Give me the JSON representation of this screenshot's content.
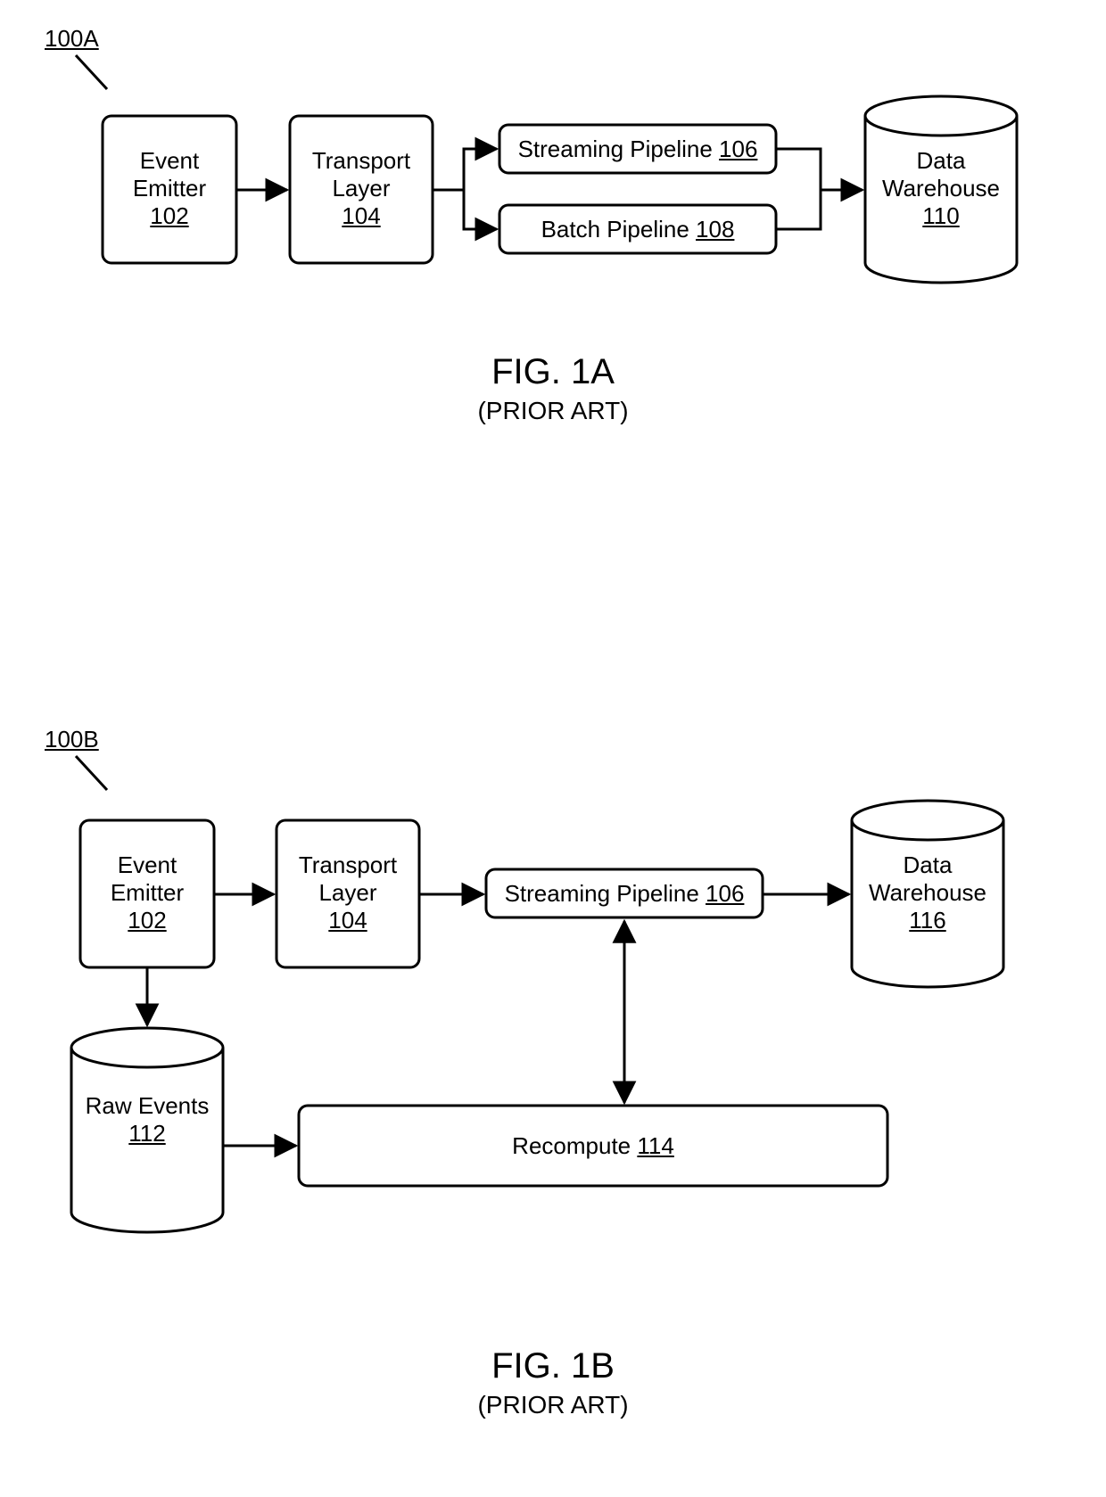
{
  "figA": {
    "ref": "100A",
    "title": "FIG. 1A",
    "subtitle": "(PRIOR ART)",
    "eventEmitter": {
      "label": "Event Emitter",
      "num": "102"
    },
    "transportLayer": {
      "label": "Transport Layer",
      "num": "104"
    },
    "streamingPipeline": {
      "label": "Streaming Pipeline ",
      "num": "106"
    },
    "batchPipeline": {
      "label": "Batch Pipeline ",
      "num": "108"
    },
    "dataWarehouse": {
      "label": "Data Warehouse",
      "num": "110"
    }
  },
  "figB": {
    "ref": "100B",
    "title": "FIG. 1B",
    "subtitle": "(PRIOR ART)",
    "eventEmitter": {
      "label": "Event Emitter",
      "num": "102"
    },
    "transportLayer": {
      "label": "Transport Layer",
      "num": "104"
    },
    "streamingPipeline": {
      "label": "Streaming Pipeline ",
      "num": "106"
    },
    "dataWarehouse": {
      "label": "Data Warehouse",
      "num": "116"
    },
    "rawEvents": {
      "label": "Raw Events",
      "num": "112"
    },
    "recompute": {
      "label": "Recompute ",
      "num": "114"
    }
  }
}
